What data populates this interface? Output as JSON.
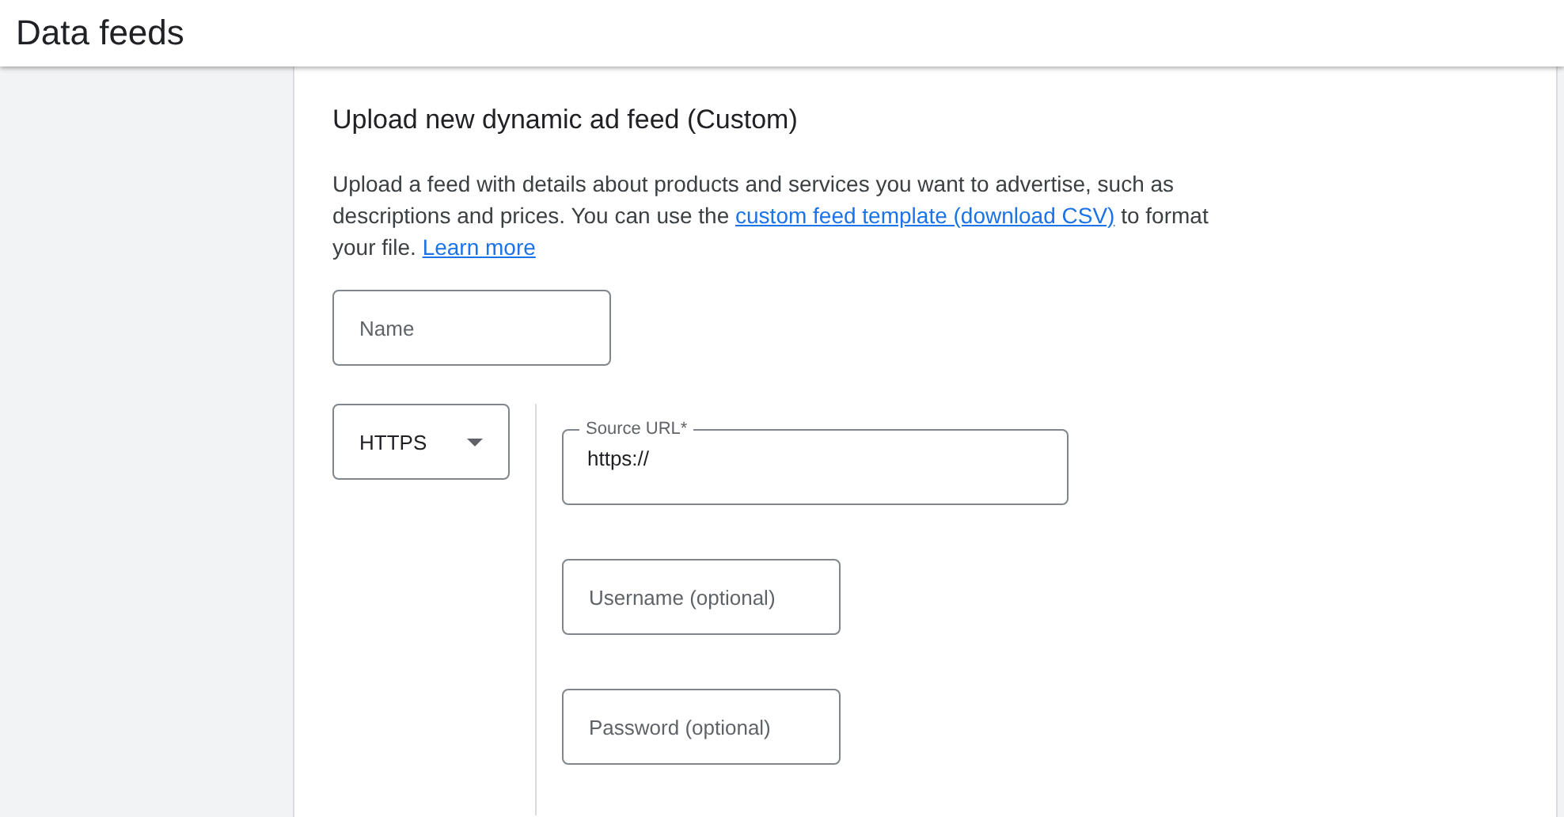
{
  "header": {
    "title": "Data feeds"
  },
  "form": {
    "title": "Upload new dynamic ad feed (Custom)",
    "description": {
      "text_before": "Upload a feed with details about products and services you want to advertise, such as descriptions and prices. You can use the ",
      "template_link": "custom feed template (download CSV)",
      "text_middle": " to format your file.",
      "learn_more_link": "Learn more"
    },
    "name_field": {
      "placeholder": "Name"
    },
    "protocol_select": {
      "value": "HTTPS"
    },
    "source_url": {
      "label": "Source URL*",
      "value": "https://"
    },
    "username_field": {
      "placeholder": "Username (optional)"
    },
    "password_field": {
      "placeholder": "Password (optional)"
    }
  }
}
